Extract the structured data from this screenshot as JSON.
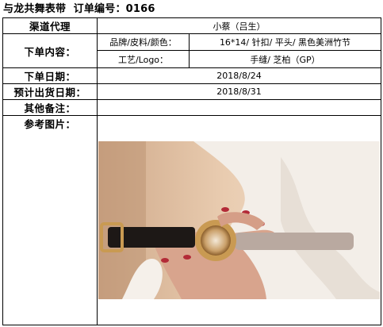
{
  "header": {
    "shop_name": "与龙共舞表带",
    "order_label": "订单编号：",
    "order_number": "0166"
  },
  "rows": {
    "channel": {
      "label": "渠道代理",
      "value": "小蔡（吕生）"
    },
    "content": {
      "label": "下单内容：",
      "brand_label": "品牌/皮料/颜色：",
      "brand_value": "16*14/ 针扣/ 平头/ 黑色美洲竹节",
      "craft_label": "工艺/Logo：",
      "craft_value": "手缝/ 芝柏（GP）"
    },
    "order_date": {
      "label": "下单日期：",
      "value": "2018/8/24"
    },
    "ship_date": {
      "label": "预计出货日期：",
      "value": "2018/8/31"
    },
    "remarks": {
      "label": "其他备注：",
      "value": ""
    },
    "reference": {
      "label": "参考图片："
    }
  },
  "photo": {
    "subject": "watch-on-black-strap-held-in-hand",
    "colors": {
      "background": "#e6c9ad",
      "fabric": "#f1ece6",
      "skin": "#d9a690",
      "nails": "#b32a37",
      "strap": "#1d1816",
      "gold": "#c99a52"
    }
  }
}
